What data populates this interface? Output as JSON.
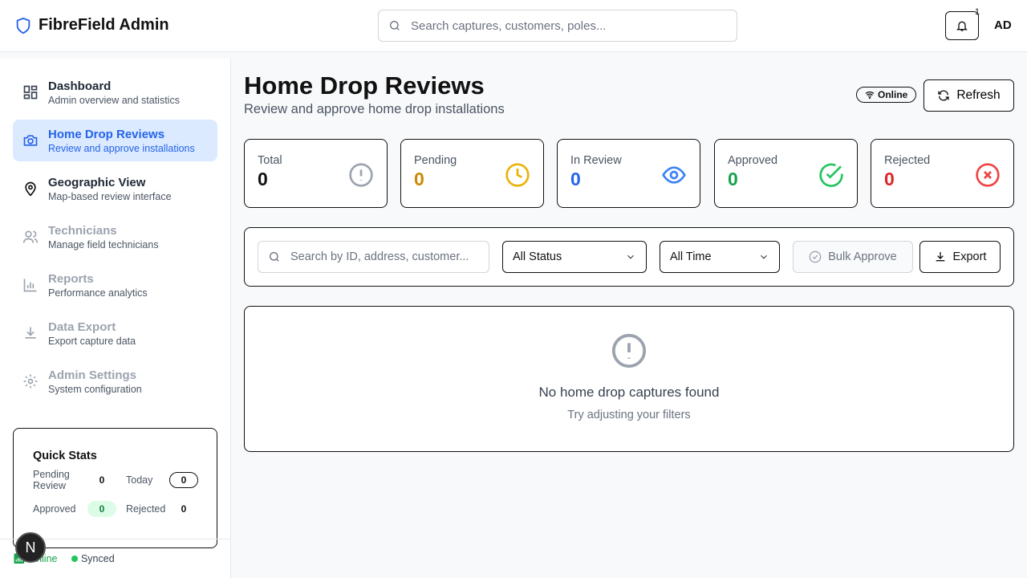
{
  "app": {
    "title": "FibreField Admin"
  },
  "header": {
    "search_placeholder": "Search captures, customers, poles...",
    "notification_count": "1",
    "avatar": "AD"
  },
  "sidebar": {
    "items": [
      {
        "label": "Dashboard",
        "sub": "Admin overview and statistics"
      },
      {
        "label": "Home Drop Reviews",
        "sub": "Review and approve installations"
      },
      {
        "label": "Geographic View",
        "sub": "Map-based review interface"
      },
      {
        "label": "Technicians",
        "sub": "Manage field technicians"
      },
      {
        "label": "Reports",
        "sub": "Performance analytics"
      },
      {
        "label": "Data Export",
        "sub": "Export capture data"
      },
      {
        "label": "Admin Settings",
        "sub": "System configuration"
      }
    ],
    "quick_stats": {
      "title": "Quick Stats",
      "pending_label": "Pending Review",
      "pending": "0",
      "today_label": "Today",
      "today": "0",
      "approved_label": "Approved",
      "approved": "0",
      "rejected_label": "Rejected",
      "rejected": "0"
    },
    "footer": {
      "online": "Online",
      "synced": "Synced"
    },
    "dev_button": "N"
  },
  "page": {
    "title": "Home Drop Reviews",
    "subtitle": "Review and approve home drop installations",
    "status": "Online",
    "refresh": "Refresh"
  },
  "stats": [
    {
      "label": "Total",
      "value": "0",
      "color": "#111111"
    },
    {
      "label": "Pending",
      "value": "0",
      "color": "#ca8a04"
    },
    {
      "label": "In Review",
      "value": "0",
      "color": "#2563eb"
    },
    {
      "label": "Approved",
      "value": "0",
      "color": "#16a34a"
    },
    {
      "label": "Rejected",
      "value": "0",
      "color": "#dc2626"
    }
  ],
  "filters": {
    "search_placeholder": "Search by ID, address, customer...",
    "status": "All Status",
    "time": "All Time",
    "bulk_approve": "Bulk Approve",
    "export": "Export"
  },
  "empty": {
    "title": "No home drop captures found",
    "hint": "Try adjusting your filters"
  }
}
